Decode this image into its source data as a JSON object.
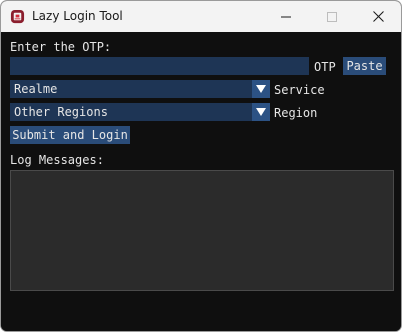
{
  "window": {
    "title": "Lazy Login Tool",
    "icon": "app-logo-icon",
    "controls": [
      "minimize-icon",
      "maximize-icon",
      "close-icon"
    ]
  },
  "otp": {
    "prompt": "Enter the OTP:",
    "value": "",
    "field_label": "OTP",
    "paste_label": "Paste"
  },
  "service": {
    "selected": "Realme",
    "label": "Service"
  },
  "region": {
    "selected": "Other Regions",
    "label": "Region"
  },
  "submit_label": "Submit and Login",
  "log": {
    "label": "Log Messages:",
    "content": ""
  },
  "colors": {
    "background": "#0f0f0f",
    "field": "#1e3555",
    "button": "#2a4c79",
    "log_box": "#2b2b2b",
    "text": "#e6e6e6"
  }
}
